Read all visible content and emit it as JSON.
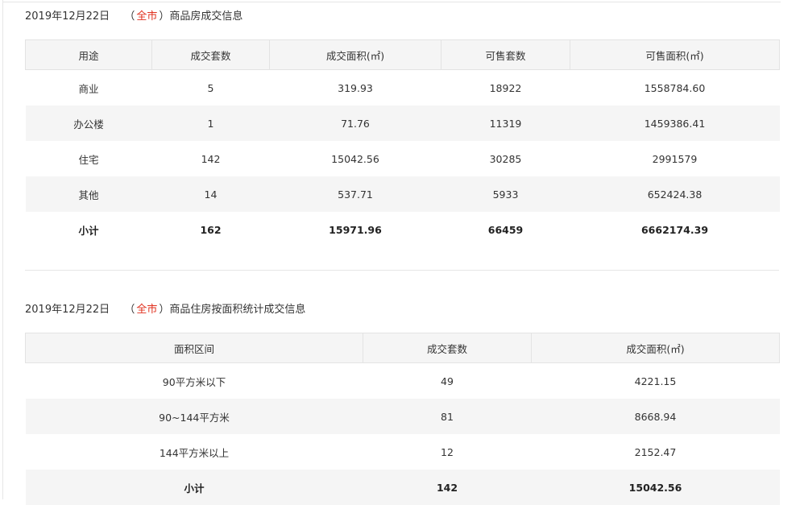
{
  "section1": {
    "date": "2019年12月22日",
    "paren_open": "（",
    "city": "全市",
    "paren_close": "）",
    "title": "商品房成交信息",
    "columns": [
      "用途",
      "成交套数",
      "成交面积(㎡)",
      "可售套数",
      "可售面积(㎡)"
    ],
    "rows": [
      [
        "商业",
        "5",
        "319.93",
        "18922",
        "1558784.60"
      ],
      [
        "办公楼",
        "1",
        "71.76",
        "11319",
        "1459386.41"
      ],
      [
        "住宅",
        "142",
        "15042.56",
        "30285",
        "2991579"
      ],
      [
        "其他",
        "14",
        "537.71",
        "5933",
        "652424.38"
      ]
    ],
    "total": [
      "小计",
      "162",
      "15971.96",
      "66459",
      "6662174.39"
    ]
  },
  "section2": {
    "date": "2019年12月22日",
    "paren_open": "（",
    "city": "全市",
    "paren_close": "）",
    "title": "商品住房按面积统计成交信息",
    "columns": [
      "面积区间",
      "成交套数",
      "成交面积(㎡)"
    ],
    "rows": [
      [
        "90平方米以下",
        "49",
        "4221.15"
      ],
      [
        "90~144平方米",
        "81",
        "8668.94"
      ],
      [
        "144平方米以上",
        "12",
        "2152.47"
      ]
    ],
    "total": [
      "小计",
      "142",
      "15042.56"
    ]
  },
  "colors": {
    "accent": "#e0301e",
    "header_bg": "#f5f5f5",
    "border": "#e3e3e3"
  }
}
